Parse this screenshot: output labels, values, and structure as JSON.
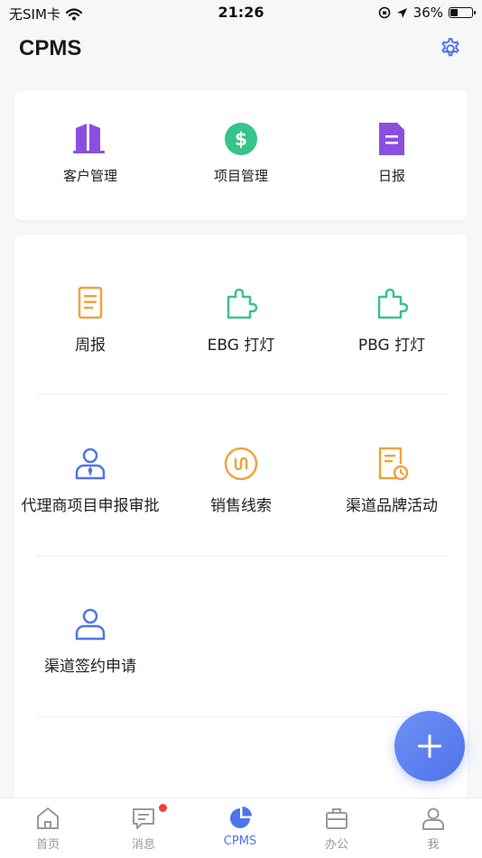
{
  "status_bar": {
    "carrier": "无SIM卡",
    "time": "21:26",
    "battery_percent": "36%",
    "battery_level": 0.36
  },
  "header": {
    "title": "CPMS"
  },
  "top_card": {
    "items": [
      {
        "label": "客户管理",
        "icon": "building-icon",
        "color": "#8a4fe0"
      },
      {
        "label": "项目管理",
        "icon": "dollar-icon",
        "color": "#35c48a"
      },
      {
        "label": "日报",
        "icon": "document-icon",
        "color": "#8a4fe0"
      }
    ]
  },
  "main_card": {
    "items": [
      {
        "label": "周报",
        "icon": "report-icon",
        "color": "#f0a23c"
      },
      {
        "label": "EBG 打灯",
        "icon": "puzzle-icon",
        "color": "#35c48a"
      },
      {
        "label": "PBG 打灯",
        "icon": "puzzle-icon",
        "color": "#35c48a"
      },
      {
        "label": "代理商项目申报审批",
        "icon": "agent-icon",
        "color": "#4f74ea"
      },
      {
        "label": "销售线索",
        "icon": "clue-icon",
        "color": "#f0a23c"
      },
      {
        "label": "渠道品牌活动",
        "icon": "activity-icon",
        "color": "#f0a23c"
      },
      {
        "label": "渠道签约申请",
        "icon": "user-icon",
        "color": "#4f74ea"
      }
    ]
  },
  "tabbar": {
    "tabs": [
      {
        "label": "首页",
        "icon": "home-icon",
        "active": false
      },
      {
        "label": "消息",
        "icon": "message-icon",
        "active": false,
        "badge": true
      },
      {
        "label": "CPMS",
        "icon": "pie-chart-icon",
        "active": true
      },
      {
        "label": "办公",
        "icon": "briefcase-icon",
        "active": false
      },
      {
        "label": "我",
        "icon": "profile-icon",
        "active": false
      }
    ]
  },
  "colors": {
    "accent": "#4f74ea",
    "purple": "#8a4fe0",
    "green": "#35c48a",
    "orange": "#f0a23c",
    "badge_red": "#f04136"
  }
}
